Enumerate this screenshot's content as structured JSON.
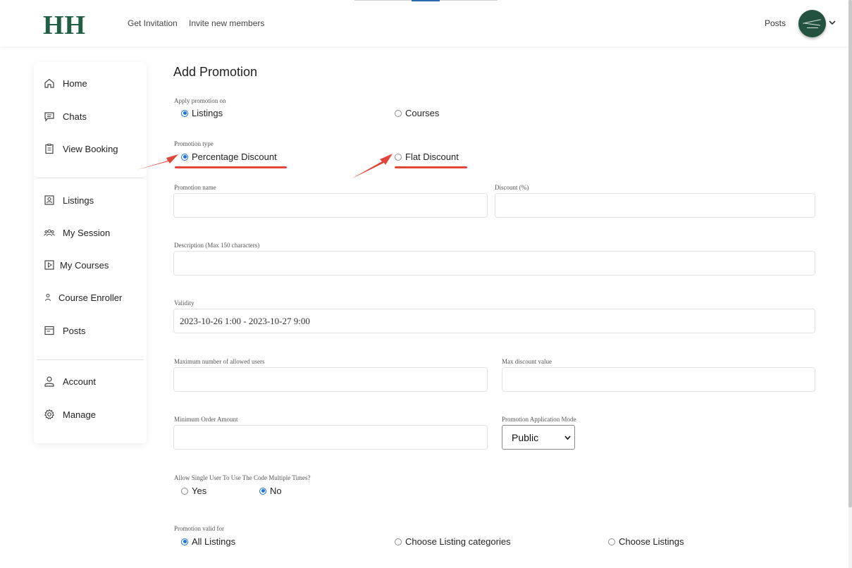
{
  "header": {
    "logo": "HH",
    "nav": [
      "Get Invitation",
      "Invite new members"
    ],
    "posts": "Posts",
    "avatar_icon": "user-avatar"
  },
  "sidebar": {
    "items": [
      {
        "label": "Home",
        "icon": "home-icon"
      },
      {
        "label": "Chats",
        "icon": "chat-icon"
      },
      {
        "label": "View Booking",
        "icon": "booking-icon"
      },
      {
        "label": "Listings",
        "icon": "listing-icon"
      },
      {
        "label": "My Session",
        "icon": "group-icon"
      },
      {
        "label": "My Courses",
        "icon": "play-icon"
      },
      {
        "label": "Course Enroller",
        "icon": "person-icon"
      },
      {
        "label": "Posts",
        "icon": "posts-icon"
      },
      {
        "label": "Account",
        "icon": "account-icon"
      },
      {
        "label": "Manage",
        "icon": "gear-icon"
      }
    ]
  },
  "form": {
    "title": "Add Promotion",
    "apply_on": {
      "label": "Apply promotion on",
      "options": [
        "Listings",
        "Courses"
      ],
      "selected": "Listings"
    },
    "promotion_type": {
      "label": "Promotion type",
      "options": [
        "Percentage Discount",
        "Flat Discount"
      ],
      "selected": "Percentage Discount"
    },
    "promotion_name": {
      "label": "Promotion name",
      "value": ""
    },
    "discount": {
      "label": "Discount (%)",
      "value": ""
    },
    "description": {
      "label": "Description (Max 150 characters)",
      "value": ""
    },
    "validity": {
      "label": "Validity",
      "value": "2023-10-26 1:00 - 2023-10-27 9:00"
    },
    "max_users": {
      "label": "Maximum number of allowed users",
      "value": ""
    },
    "max_discount": {
      "label": "Max discount value",
      "value": ""
    },
    "min_order": {
      "label": "Minimum Order Amount",
      "value": ""
    },
    "application_mode": {
      "label": "Promotion Application Mode",
      "value": "Public"
    },
    "multi_use": {
      "label": "Allow Single User To Use The Code Multiple Times?",
      "options": [
        "Yes",
        "No"
      ],
      "selected": "No"
    },
    "valid_for": {
      "label": "Promotion valid for",
      "options": [
        "All Listings",
        "Choose Listing categories",
        "Choose Listings"
      ],
      "selected": "All Listings"
    }
  },
  "colors": {
    "brand": "#1f5f45",
    "accent": "#1a73e8",
    "annotation": "#e0473b"
  }
}
